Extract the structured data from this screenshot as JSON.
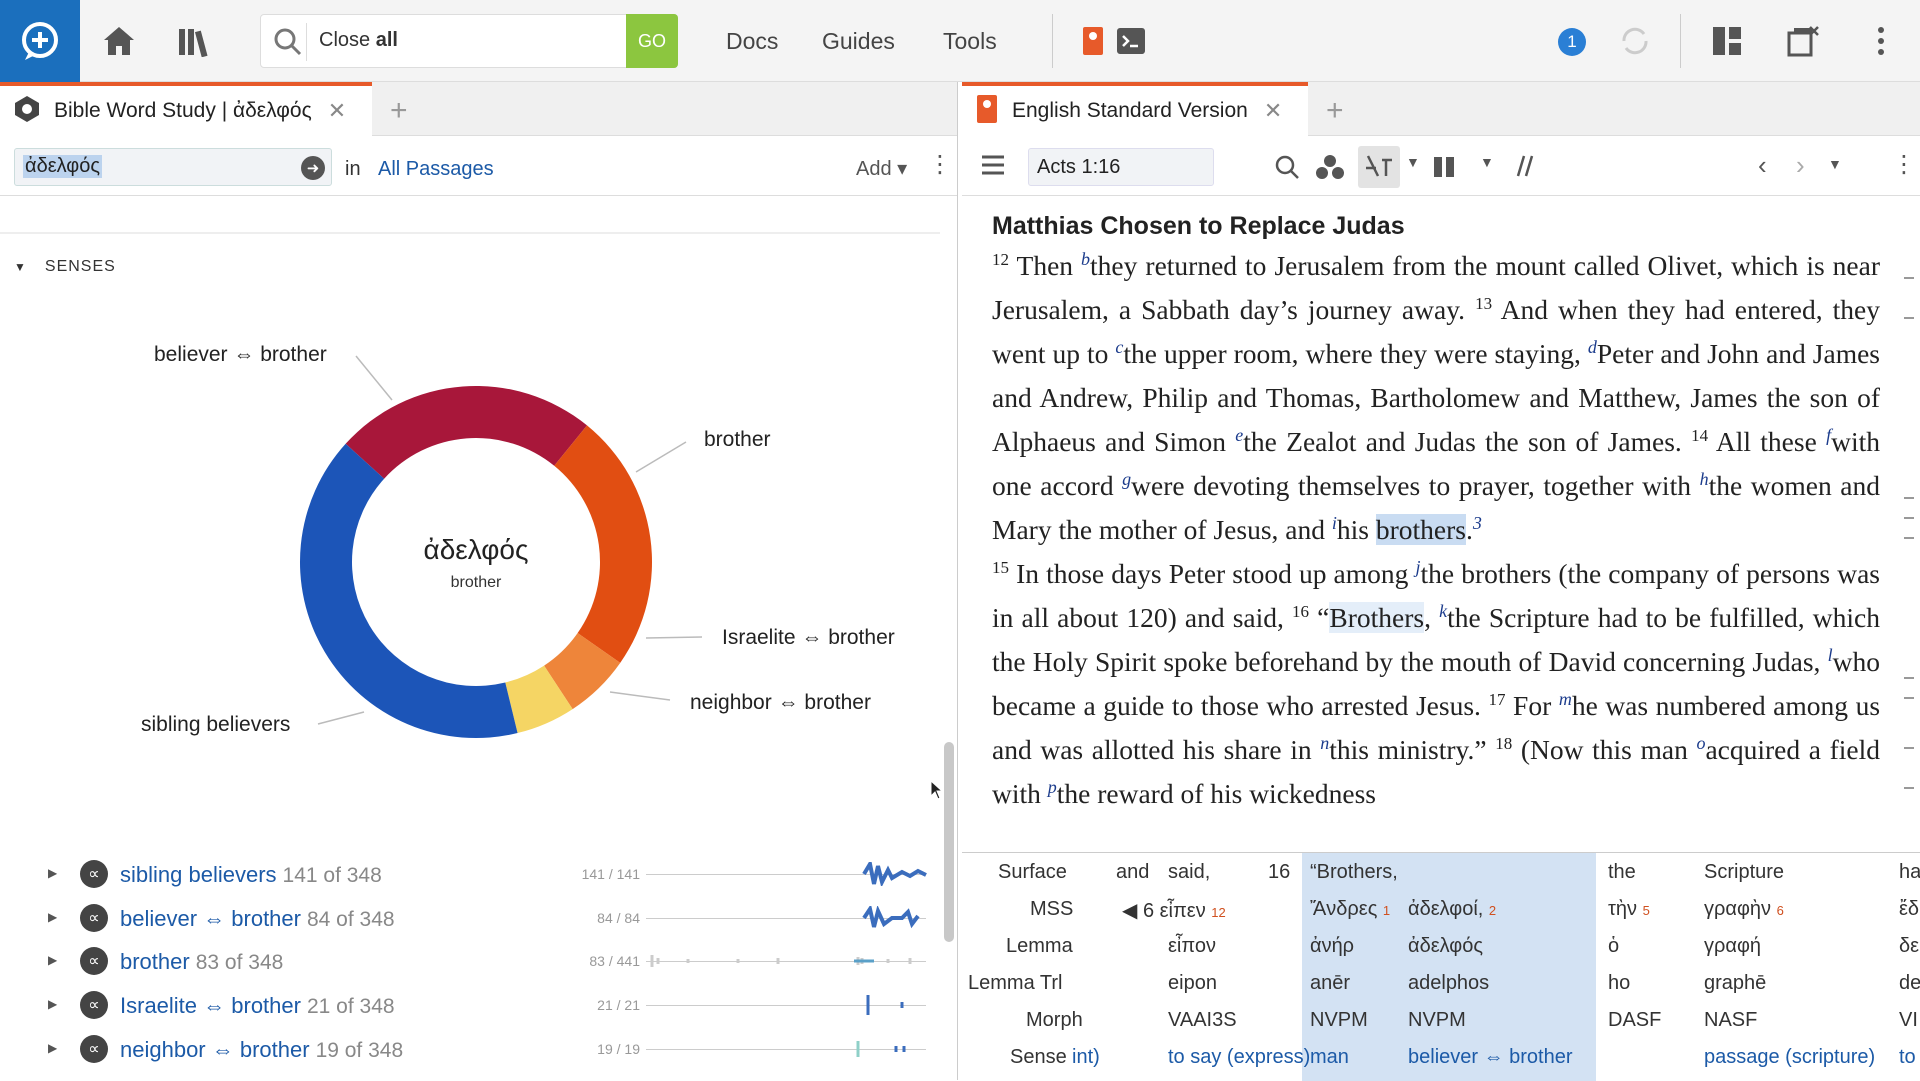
{
  "toolbar": {
    "search_command_prefix": "Close",
    "search_command_bold": "all",
    "go_label": "GO",
    "nav": [
      "Docs",
      "Guides",
      "Tools"
    ],
    "notification_count": "1"
  },
  "left_panel": {
    "tab_title": "Bible Word Study | ἀδελφός",
    "search_term": "ἀδελφός",
    "in_label": "in",
    "range_label": "All Passages",
    "add_label": "Add",
    "senses_header": "SENSES",
    "chart_data": {
      "type": "pie",
      "center_word": "ἀδελφός",
      "center_gloss": "brother",
      "categories": [
        "sibling believers",
        "believer ⇔ brother",
        "brother",
        "Israelite ⇔ brother",
        "neighbor ⇔ brother"
      ],
      "values": [
        141,
        84,
        83,
        21,
        19
      ],
      "colors": [
        "#1c55b8",
        "#a8173a",
        "#e14e12",
        "#ee853a",
        "#f5d564"
      ]
    },
    "senses": [
      {
        "name": "sibling believers",
        "count": "141 of 348",
        "ratio": "141 / 141"
      },
      {
        "name": "believer ⇔ brother",
        "count": "84 of 348",
        "ratio": "84 / 84"
      },
      {
        "name": "brother",
        "count": "83 of 348",
        "ratio": "83 / 441"
      },
      {
        "name": "Israelite ⇔ brother",
        "count": "21 of 348",
        "ratio": "21 / 21"
      },
      {
        "name": "neighbor ⇔ brother",
        "count": "19 of 348",
        "ratio": "19 / 19"
      }
    ]
  },
  "right_panel": {
    "tab_title": "English Standard Version",
    "reference": "Acts 1:16",
    "heading": "Matthias Chosen to Replace Judas",
    "interlinear": {
      "row_labels": [
        "Surface",
        "MSS",
        "Lemma",
        "Lemma Trl",
        "Morph",
        "Sense"
      ],
      "columns": [
        {
          "surface": "and",
          "mss": "",
          "lemma": "",
          "trl": "",
          "morph": "",
          "sense": "int)"
        },
        {
          "surface": "said,",
          "mss": "◀ 6  εἶπεν",
          "mss_num": "12",
          "lemma": "εἶπον",
          "trl": "eipon",
          "morph": "VAAI3S",
          "sense": "to say (express)"
        },
        {
          "surface": "16",
          "mss": "",
          "lemma": "",
          "trl": "",
          "morph": "",
          "sense": ""
        },
        {
          "surface": "“Brothers,",
          "mss": "Ἄνδρες",
          "mss_num": "1",
          "lemma": "ἀνήρ",
          "trl": "anēr",
          "morph": "NVPM",
          "sense": "man"
        },
        {
          "surface": "",
          "mss": "ἀδελφοί,",
          "mss_num": "2",
          "lemma": "ἀδελφός",
          "trl": "adelphos",
          "morph": "NVPM",
          "sense": "believer ⇔ brother"
        },
        {
          "surface": "the",
          "mss": "τὴν",
          "mss_num": "5",
          "lemma": "ὁ",
          "trl": "ho",
          "morph": "DASF",
          "sense": ""
        },
        {
          "surface": "Scripture",
          "mss": "γραφὴν",
          "mss_num": "6",
          "lemma": "γραφή",
          "trl": "graphē",
          "morph": "NASF",
          "sense": "passage (scripture)"
        },
        {
          "surface": "ha",
          "mss": "ἔδ",
          "lemma": "δε",
          "trl": "de",
          "morph": "VI",
          "sense": "to"
        }
      ]
    }
  }
}
